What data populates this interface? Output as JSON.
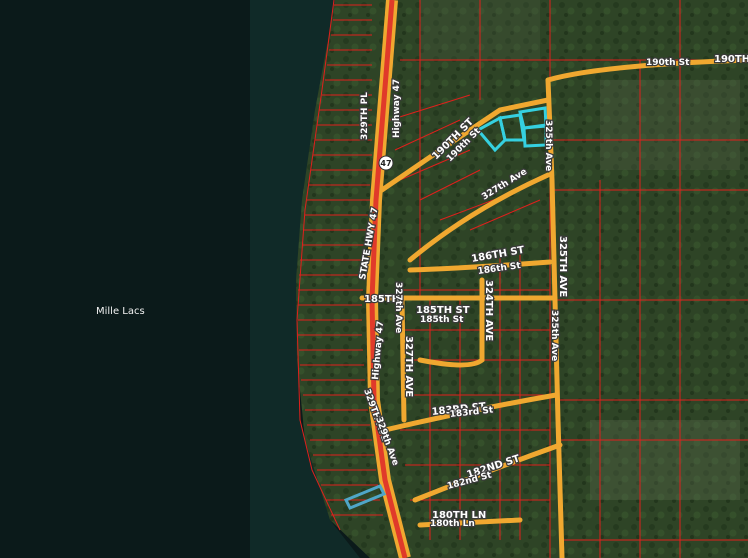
{
  "map": {
    "water_label": "Mille Lacs",
    "highway_shield": "47",
    "colors": {
      "water": "#0b1a1a",
      "land": "#2d4224",
      "road_fill": "#f0a830",
      "highway_fill": "#e03a2a",
      "parcel_lines": "#e0201c",
      "selected_parcels": "#35d0e0",
      "selected_parcel_small": "#4fa6c8"
    },
    "road_labels": {
      "r190th_st_1": "190th St",
      "r190th_st_2": "190TH",
      "r190th_st_3": "190TH ST",
      "r190th_st_4": "190th St",
      "r329th_pl": "329TH PL",
      "highway_47_a": "Highway 47",
      "highway_47_b": "Highway 47",
      "state_hwy_47": "STATE HWY 47",
      "r325th_ave_1": "325th Ave",
      "r325th_ave_2": "325TH AVE",
      "r325th_ave_3": "325th Ave",
      "r327th_ave": "327th Ave",
      "r186th_st_1": "186TH ST",
      "r186th_st_2": "186th St",
      "r185th_1": "185TH",
      "r185th_st_1": "185TH ST",
      "r185th_st_2": "185th St",
      "r327th_ave_2": "327th Ave",
      "r327th_ave_3": "327TH AVE",
      "r324th_ave": "324TH AVE",
      "r183rd_st_1": "183RD ST",
      "r183rd_st_2": "183rd St",
      "r182nd_st_1": "182ND ST",
      "r182nd_st_2": "182nd St",
      "r329th_ave_1": "329TH AVE",
      "r329th_ave_2": "329th Ave",
      "r180th_ln_1": "180TH LN",
      "r180th_ln_2": "180th Ln"
    }
  }
}
